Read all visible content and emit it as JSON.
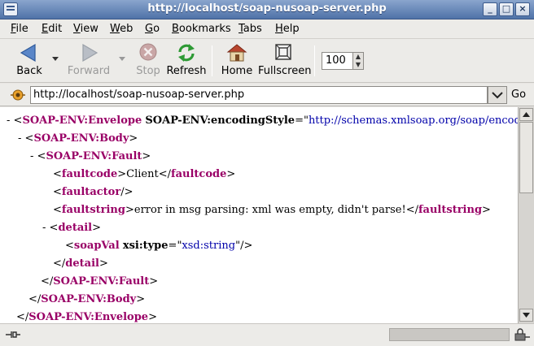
{
  "window": {
    "title": "http://localhost/soap-nusoap-server.php",
    "buttons": {
      "minimize": "_",
      "maximize": "□",
      "close": "×"
    }
  },
  "menu": {
    "items": [
      {
        "label": "File",
        "mnemonic": "F",
        "rest": "ile"
      },
      {
        "label": "Edit",
        "mnemonic": "E",
        "rest": "dit"
      },
      {
        "label": "View",
        "mnemonic": "V",
        "rest": "iew"
      },
      {
        "label": "Web",
        "mnemonic": "W",
        "rest": "eb"
      },
      {
        "label": "Go",
        "mnemonic": "G",
        "rest": "o"
      },
      {
        "label": "Bookmarks",
        "mnemonic": "B",
        "rest": "ookmarks"
      },
      {
        "label": "Tabs",
        "mnemonic": "T",
        "rest": "abs"
      },
      {
        "label": "Help",
        "mnemonic": "H",
        "rest": "elp"
      }
    ]
  },
  "toolbar": {
    "back": "Back",
    "forward": "Forward",
    "stop": "Stop",
    "refresh": "Refresh",
    "home": "Home",
    "fullscreen": "Fullscreen",
    "zoom_value": "100",
    "icons": {
      "back": "back-arrow-icon",
      "forward": "forward-arrow-icon",
      "stop": "stop-icon",
      "refresh": "refresh-icon",
      "home": "home-icon",
      "fullscreen": "fullscreen-icon"
    }
  },
  "location": {
    "url": "http://localhost/soap-nusoap-server.php",
    "go_label": "Go"
  },
  "xml": {
    "l1_toggle": "-",
    "l1_tag": "SOAP-ENV:Envelope",
    "l1_attr": "SOAP-ENV:encodingStyle",
    "l1_value": "http://schemas.xmlsoap.org/soap/encoding/",
    "l2_toggle": "-",
    "l2_tag": "SOAP-ENV:Body",
    "l3_toggle": "-",
    "l3_tag": "SOAP-ENV:Fault",
    "l4_tag": "faultcode",
    "l4_text": "Client",
    "l5_tag": "faultactor",
    "l6_tag": "faultstring",
    "l6_text": "error in msg parsing: xml was empty, didn't parse!",
    "l7_toggle": "-",
    "l7_tag": "detail",
    "l8_tag": "soapVal",
    "l8_attr": "xsi:type",
    "l8_value": "xsd:string",
    "l9_tag": "detail",
    "l10_tag": "SOAP-ENV:Fault",
    "l11_tag": "SOAP-ENV:Body",
    "l12_tag": "SOAP-ENV:Envelope"
  },
  "colors": {
    "tag": "#990066",
    "attr_value": "#0000aa",
    "titlebar": "#5a7cb0"
  }
}
